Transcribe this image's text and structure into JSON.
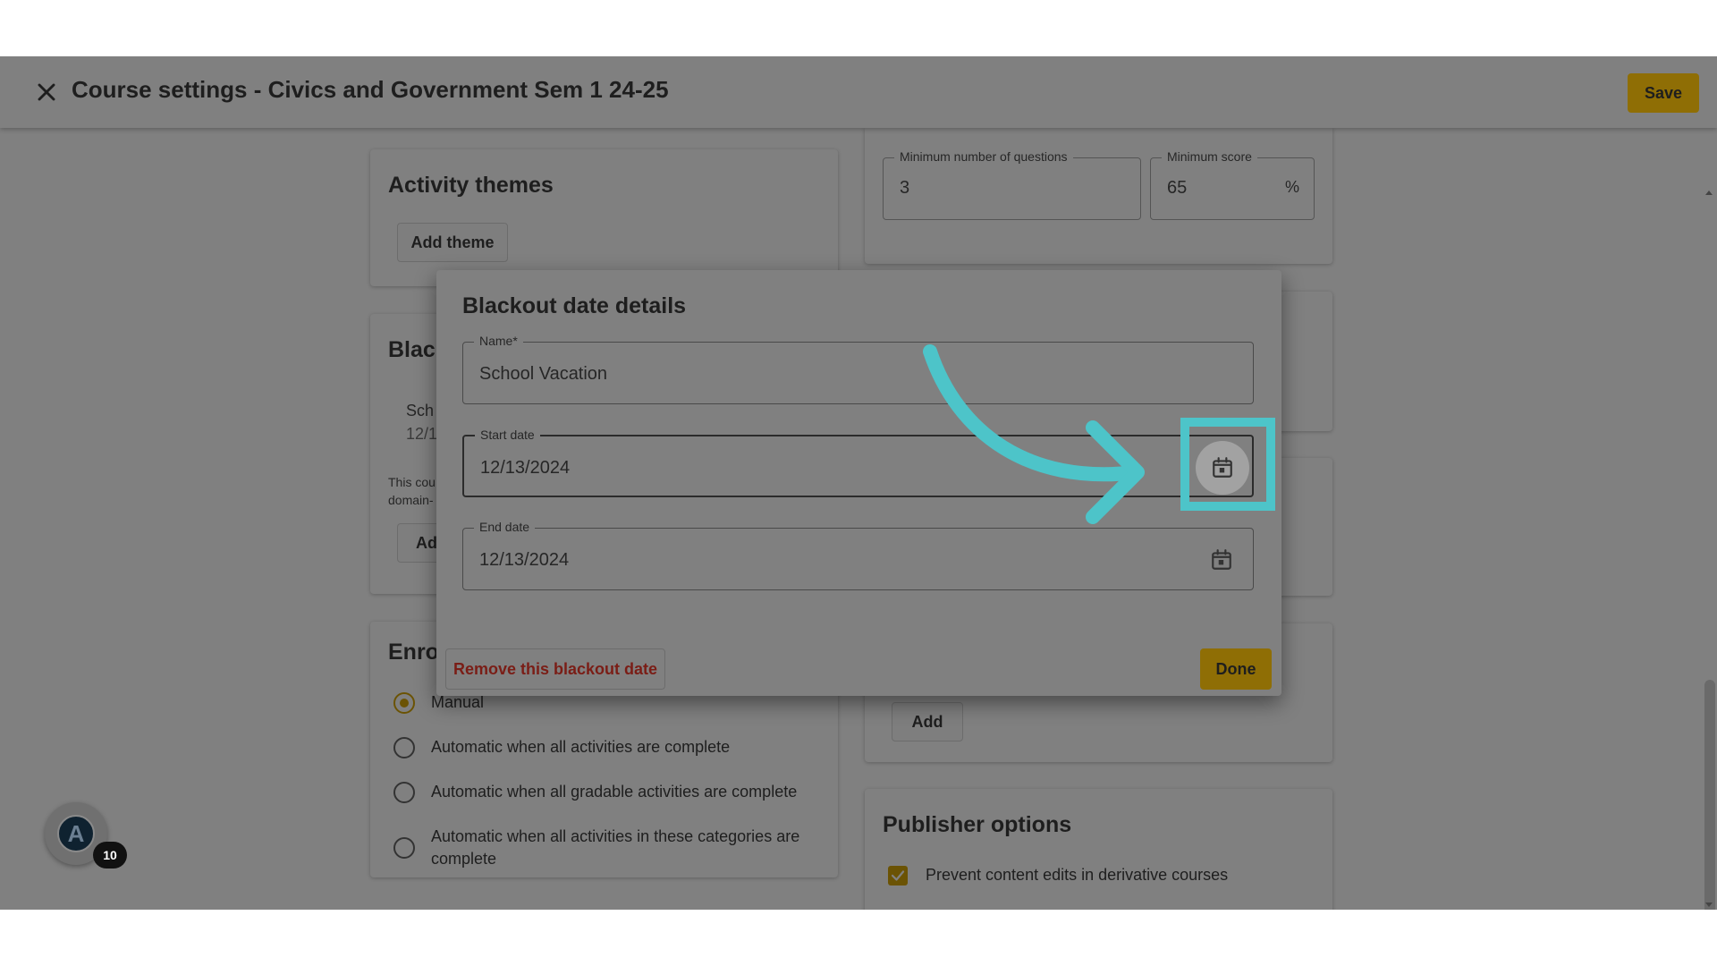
{
  "header": {
    "title": "Course settings - Civics and Government Sem 1 24-25",
    "save_label": "Save"
  },
  "activity_themes": {
    "title": "Activity themes",
    "add_theme_label": "Add theme"
  },
  "blackout_card": {
    "title_partial": "Blac",
    "item_name_partial": "Sch",
    "item_date_partial": "12/1",
    "note_line1": "This cou",
    "note_line2": "domain-",
    "add_partial": "Ad"
  },
  "enrollment": {
    "title_partial": "Enrol",
    "options": [
      {
        "label": "Manual",
        "selected": true
      },
      {
        "label": "Automatic when all activities are complete",
        "selected": false
      },
      {
        "label": "Automatic when all gradable activities are complete",
        "selected": false
      },
      {
        "label": "Automatic when all activities in these categories are complete",
        "selected": false
      }
    ]
  },
  "mastery": {
    "min_questions_label": "Minimum number of questions",
    "min_questions_value": "3",
    "min_score_label": "Minimum score",
    "min_score_value": "65",
    "min_score_unit": "%"
  },
  "right_add": {
    "add_label": "Add"
  },
  "publisher": {
    "title": "Publisher options",
    "prevent_edits_label": "Prevent content edits in derivative courses",
    "prevent_edits_checked": true
  },
  "fab": {
    "logo_letter": "A",
    "badge_count": "10"
  },
  "dialog": {
    "title": "Blackout date details",
    "name_label": "Name*",
    "name_value": "School Vacation",
    "start_label": "Start date",
    "start_value": "12/13/2024",
    "end_label": "End date",
    "end_value": "12/13/2024",
    "remove_label": "Remove this blackout date",
    "done_label": "Done"
  },
  "icons": {
    "close": "close-icon",
    "calendar": "calendar-icon",
    "check": "check-icon"
  },
  "colors": {
    "accent": "#8f6e05",
    "annotation": "#4dc4c9",
    "danger_text": "#7a1d16",
    "overlay_background": "#808080"
  }
}
